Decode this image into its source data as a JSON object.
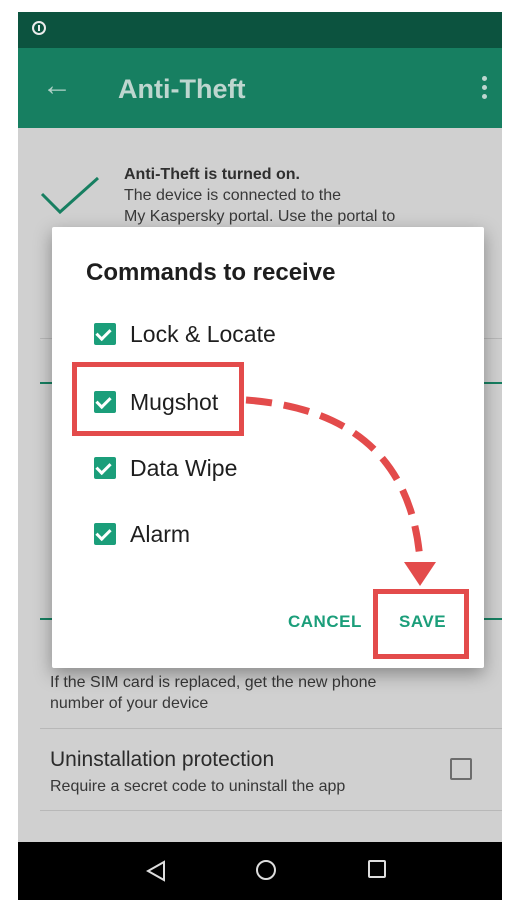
{
  "app": {
    "title": "Anti-Theft"
  },
  "background": {
    "status_heading": "Anti-Theft is turned on.",
    "status_line1": "The device is connected to the",
    "status_line2": "My Kaspersky portal. Use the portal to",
    "sim_line1": "If the SIM card is replaced, get the new phone",
    "sim_line2": "number of your device",
    "uninstall_title": "Uninstallation protection",
    "uninstall_desc": "Require a secret code to uninstall the app"
  },
  "dialog": {
    "title": "Commands to receive",
    "options": [
      {
        "label": "Lock & Locate",
        "checked": true
      },
      {
        "label": "Mugshot",
        "checked": true
      },
      {
        "label": "Data Wipe",
        "checked": true
      },
      {
        "label": "Alarm",
        "checked": true
      }
    ],
    "cancel_label": "CANCEL",
    "save_label": "SAVE"
  },
  "colors": {
    "status_bar": "#0e5b45",
    "app_bar": "#1a8a6a",
    "accent": "#1b9e7a",
    "annotation": "#e34b4b"
  },
  "icons": [
    "back-arrow-icon",
    "more-vert-icon",
    "check-icon",
    "nav-back-icon",
    "nav-home-icon",
    "nav-recents-icon"
  ]
}
